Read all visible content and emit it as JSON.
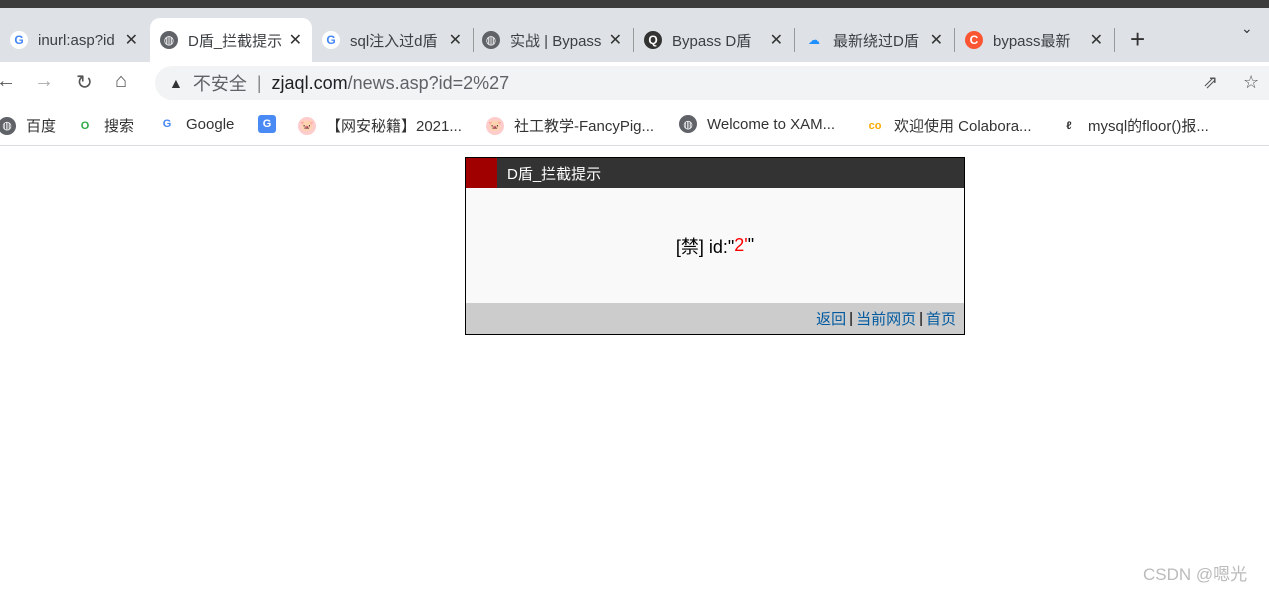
{
  "tabs": [
    {
      "title": "inurl:asp?id",
      "icon": "google-icon",
      "active": false
    },
    {
      "title": "D盾_拦截提示",
      "icon": "globe-icon",
      "active": true
    },
    {
      "title": "sql注入过d盾",
      "icon": "google-icon",
      "active": false
    },
    {
      "title": "实战 | Bypass",
      "icon": "globe-icon",
      "active": false
    },
    {
      "title": "Bypass D盾",
      "icon": "site-icon",
      "active": false
    },
    {
      "title": "最新绕过D盾",
      "icon": "cloud-icon",
      "active": false
    },
    {
      "title": "bypass最新",
      "icon": "csdn-icon",
      "active": false
    }
  ],
  "address": {
    "security": "不安全",
    "host": "zjaql.com",
    "path": "/news.asp?id=2%27"
  },
  "bookmarks": [
    {
      "label": "百度",
      "icon": "globe-icon"
    },
    {
      "label": "搜索",
      "icon": "search-logo-icon"
    },
    {
      "label": "Google",
      "icon": "google-icon"
    },
    {
      "label": "",
      "icon": "translate-icon"
    },
    {
      "label": "【网安秘籍】2021...",
      "icon": "pig-icon"
    },
    {
      "label": "社工教学-FancyPig...",
      "icon": "pig-icon"
    },
    {
      "label": "Welcome to XAM...",
      "icon": "globe-icon"
    },
    {
      "label": "欢迎使用 Colabora...",
      "icon": "colab-icon"
    },
    {
      "label": "mysql的floor()报...",
      "icon": "mysql-icon"
    }
  ],
  "dialog": {
    "title": "D盾_拦截提示",
    "prefix": "[禁] id:\"",
    "value": "2'",
    "suffix": "\"",
    "links": [
      "返回",
      "当前网页",
      "首页"
    ],
    "separator": "|"
  },
  "watermark": "CSDN @嗯光",
  "colors": {
    "header": "#333333",
    "accent": "#a00000",
    "value": "#ff0000",
    "link": "#005aa0"
  }
}
